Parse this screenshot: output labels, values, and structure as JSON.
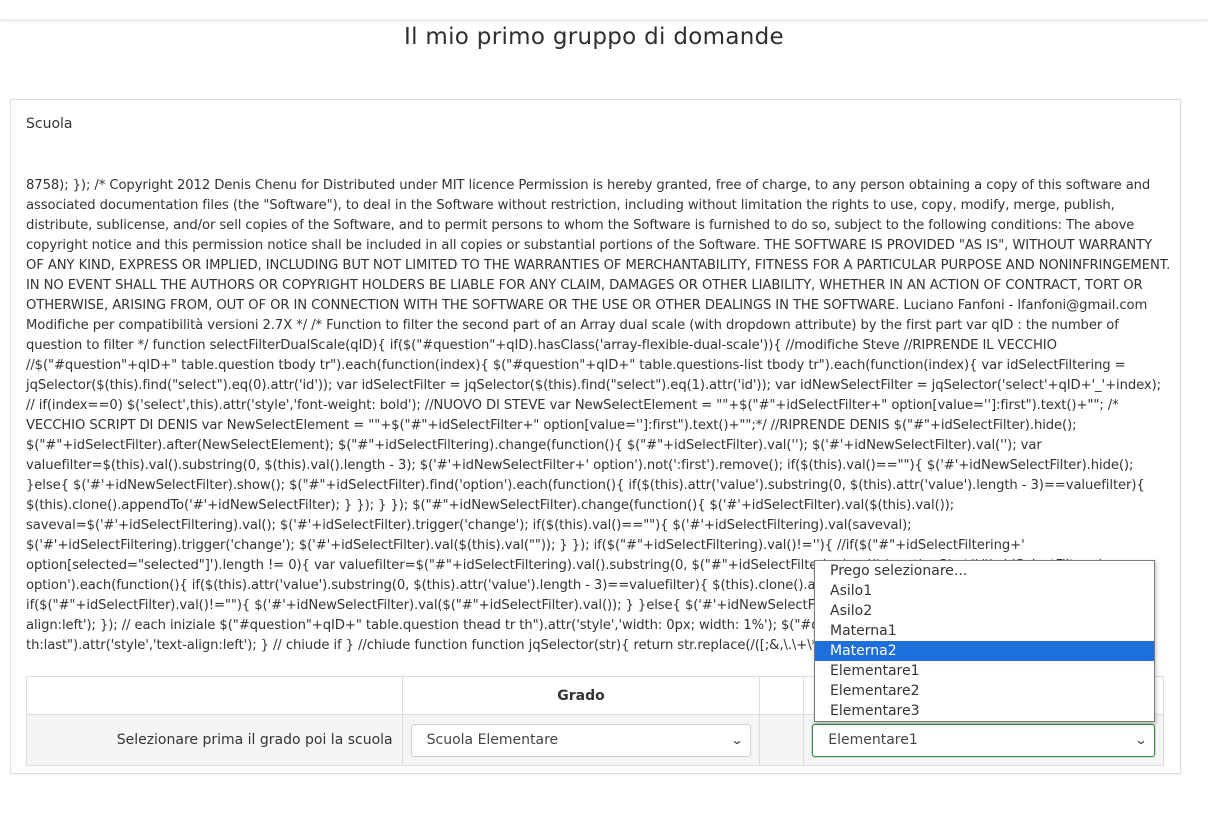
{
  "page": {
    "group_title": "Il mio primo gruppo di domande"
  },
  "question": {
    "label": "Scuola",
    "text": "8758); }); /* Copyright 2012 Denis Chenu for Distributed under MIT licence Permission is hereby granted, free of charge, to any person obtaining a copy of this software and associated documentation files (the \"Software\"), to deal in the Software without restriction, including without limitation the rights to use, copy, modify, merge, publish, distribute, sublicense, and/or sell copies of the Software, and to permit persons to whom the Software is furnished to do so, subject to the following conditions: The above copyright notice and this permission notice shall be included in all copies or substantial portions of the Software. THE SOFTWARE IS PROVIDED \"AS IS\", WITHOUT WARRANTY OF ANY KIND, EXPRESS OR IMPLIED, INCLUDING BUT NOT LIMITED TO THE WARRANTIES OF MERCHANTABILITY, FITNESS FOR A PARTICULAR PURPOSE AND NONINFRINGEMENT. IN NO EVENT SHALL THE AUTHORS OR COPYRIGHT HOLDERS BE LIABLE FOR ANY CLAIM, DAMAGES OR OTHER LIABILITY, WHETHER IN AN ACTION OF CONTRACT, TORT OR OTHERWISE, ARISING FROM, OUT OF OR IN CONNECTION WITH THE SOFTWARE OR THE USE OR OTHER DEALINGS IN THE SOFTWARE. Luciano Fanfoni - lfanfoni@gmail.com Modifiche per compatibilità versioni 2.7X */ /* Function to filter the second part of an Array dual scale (with dropdown attribute) by the first part var qID : the number of question to filter */ function selectFilterDualScale(qID){ if($(\"#question\"+qID).hasClass('array-flexible-dual-scale')){ //modifiche Steve //RIPRENDE IL VECCHIO //$(\"#question\"+qID+\" table.question tbody tr\").each(function(index){ $(\"#question\"+qID+\" table.questions-list tbody tr\").each(function(index){ var idSelectFiltering = jqSelector($(this).find(\"select\").eq(0).attr('id')); var idSelectFilter = jqSelector($(this).find(\"select\").eq(1).attr('id')); var idNewSelectFilter = jqSelector('select'+qID+'_'+index); // if(index==0) $('select',this).attr('style','font-weight: bold'); //NUOVO DI STEVE var NewSelectElement = \"\"+$(\"#\"+idSelectFilter+\" option[value='']:first\").text()+\"\"; /* VECCHIO SCRIPT DI DENIS var NewSelectElement = \"\"+$(\"#\"+idSelectFilter+\" option[value='']:first\").text()+\"\";*/ //RIPRENDE DENIS $(\"#\"+idSelectFilter).hide(); $(\"#\"+idSelectFilter).after(NewSelectElement); $(\"#\"+idSelectFiltering).change(function(){ $(\"#\"+idSelectFilter).val(''); $('#'+idNewSelectFilter).val(''); var valuefilter=$(this).val().substring(0, $(this).val().length - 3); $('#'+idNewSelectFilter+' option').not(':first').remove(); if($(this).val()==\"\"){ $('#'+idNewSelectFilter).hide(); }else{ $('#'+idNewSelectFilter).show(); $(\"#\"+idSelectFilter).find('option').each(function(){ if($(this).attr('value').substring(0, $(this).attr('value').length - 3)==valuefilter){ $(this).clone().appendTo('#'+idNewSelectFilter); } }); } }); $(\"#\"+idNewSelectFilter).change(function(){ $('#'+idSelectFilter).val($(this).val()); saveval=$('#'+idSelectFiltering).val(); $('#'+idSelectFilter).trigger('change'); if($(this).val()==\"\"){ $('#'+idSelectFiltering).val(saveval); $('#'+idSelectFiltering).trigger('change'); $('#'+idSelectFilter).val($(this).val(\"\")); } }); if($(\"#\"+idSelectFiltering).val()!=''){ //if($(\"#\"+idSelectFiltering+' option[selected=\"selected\"]').length != 0){ var valuefilter=$(\"#\"+idSelectFiltering).val().substring(0, $(\"#\"+idSelectFiltering).val().length - 3); $('#'+idSelectFilter+' option').each(function(){ if($(this).attr('value').substring(0, $(this).attr('value').length - 3)==valuefilter){ $(this).clone().appendTo('#'+idNewSelectFilter); } }); if($(\"#\"+idSelectFilter).val()!=\"\"){ $('#'+idNewSelectFilter).val($(\"#\"+idSelectFilter).val()); } }else{ $('#'+idNewSelectFilter).hide(); } $('td:last',this).attr('style','text-align:left'); }); // each iniziale $(\"#question\"+qID+\" table.question thead tr th\").attr('style','width: 0px; width: 1%'); $(\"#question\"+qID+\" table.question thead tr th:last\").attr('style','text-align:left'); } // chiude if } //chiude function function jqSelector(str){ return str.replace(/([;&,\\.\\+\\*\\~':\"\\!\\^#$%@\\[\\]\\(\\)=>\\|])/g, '\\\\$1'); }"
  },
  "table": {
    "headers": {
      "grado": "Grado"
    },
    "row_label": "Selezionare prima il grado poi la scuola",
    "grado_select_value": "Scuola Elementare",
    "scuola_select_value": "Elementare1"
  },
  "dropdown": {
    "options": [
      "Prego selezionare...",
      "Asilo1",
      "Asilo2",
      "Materna1",
      "Materna2",
      "Elementare1",
      "Elementare2",
      "Elementare3"
    ],
    "highlighted_index": 4
  },
  "colors": {
    "highlight": "#1e6fd9",
    "focus_border": "#3f8d4d"
  },
  "icons": {
    "select_arrow": "chevron-down-icon"
  }
}
